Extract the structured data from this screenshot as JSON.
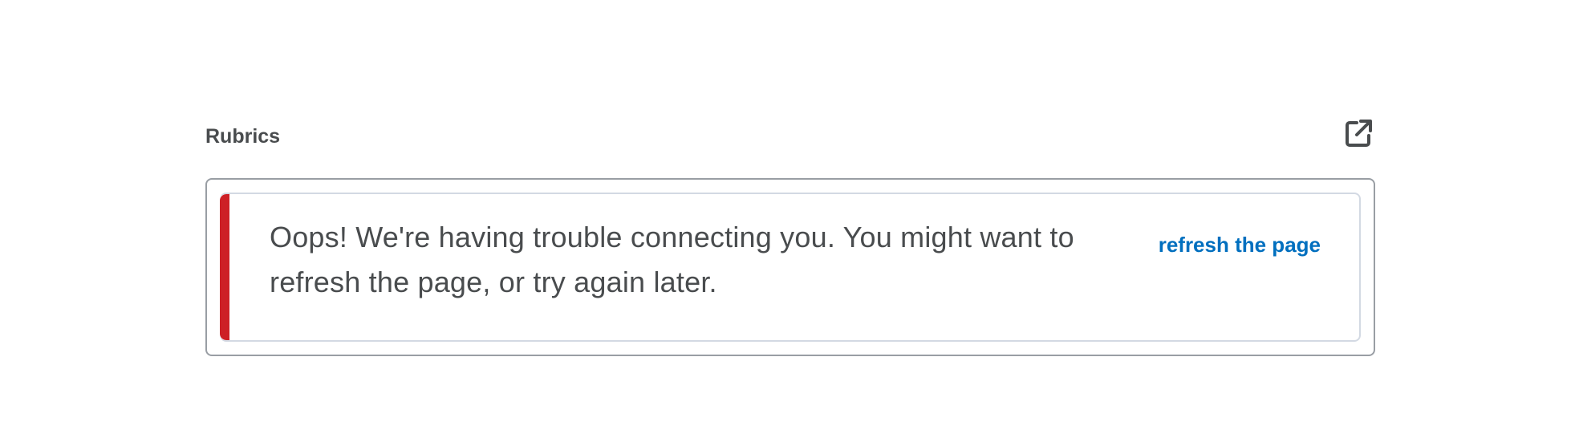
{
  "section": {
    "title": "Rubrics",
    "popout_icon": "open-in-new-window-icon"
  },
  "alert": {
    "message": "Oops! We're having trouble connecting you. You might want to refresh the page, or try again later.",
    "action_label": "refresh the page",
    "stripe_color": "#cd2026",
    "link_color": "#006fbf"
  }
}
